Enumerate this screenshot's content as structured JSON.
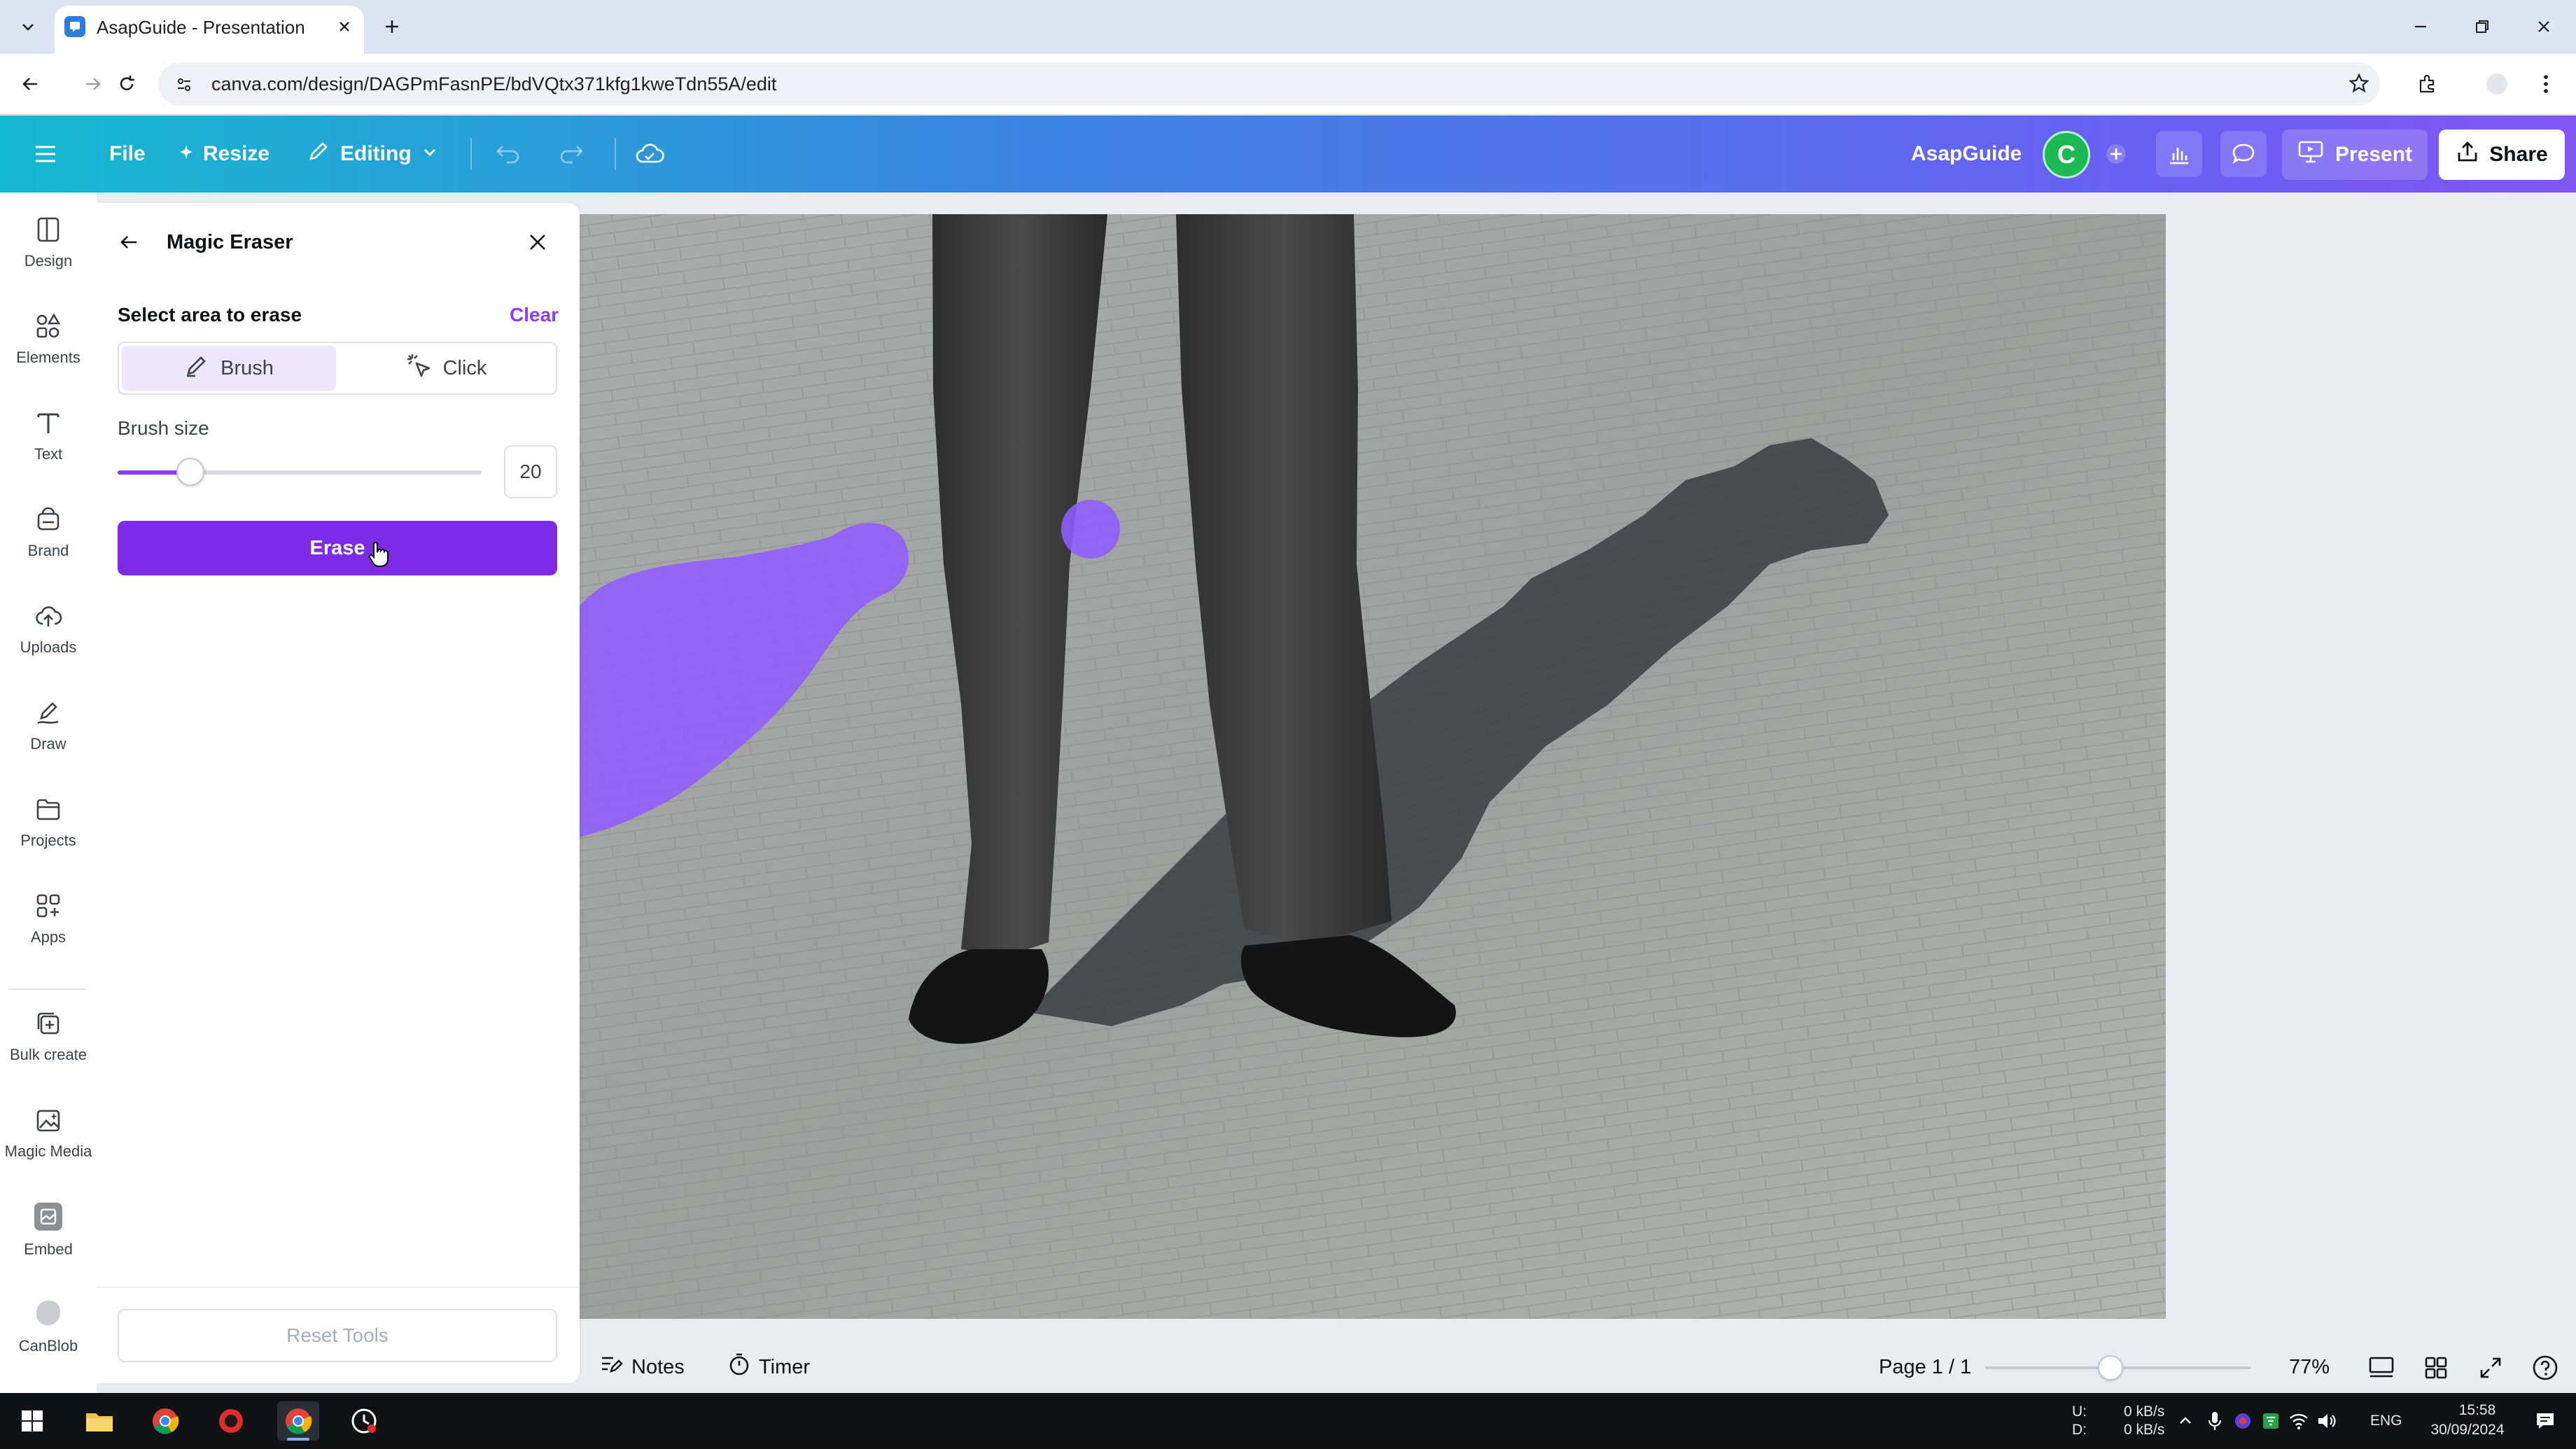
{
  "browser": {
    "tab_title": "AsapGuide - Presentation",
    "url": "canva.com/design/DAGPmFasnPE/bdVQtx371kfg1kweTdn55A/edit"
  },
  "header": {
    "file_label": "File",
    "resize_label": "Resize",
    "editing_label": "Editing",
    "team_name": "AsapGuide",
    "avatar_initial": "C",
    "present_label": "Present",
    "share_label": "Share"
  },
  "sidebar": {
    "items": [
      {
        "label": "Design",
        "icon": "design-icon"
      },
      {
        "label": "Elements",
        "icon": "elements-icon"
      },
      {
        "label": "Text",
        "icon": "text-icon"
      },
      {
        "label": "Brand",
        "icon": "brand-icon"
      },
      {
        "label": "Uploads",
        "icon": "uploads-icon"
      },
      {
        "label": "Draw",
        "icon": "draw-icon"
      },
      {
        "label": "Projects",
        "icon": "projects-icon"
      },
      {
        "label": "Apps",
        "icon": "apps-icon"
      },
      {
        "label": "Bulk create",
        "icon": "bulk-create-icon"
      },
      {
        "label": "Magic Media",
        "icon": "magic-media-icon"
      },
      {
        "label": "Embed",
        "icon": "embed-icon"
      },
      {
        "label": "CanBlob",
        "icon": "canblob-icon"
      }
    ]
  },
  "panel": {
    "title": "Magic Eraser",
    "select_label": "Select area to erase",
    "clear_label": "Clear",
    "modes": [
      "Brush",
      "Click"
    ],
    "active_mode": "Brush",
    "brush_size_label": "Brush size",
    "brush_size_value": "20",
    "brush_size_fraction": 0.2,
    "erase_label": "Erase",
    "reset_label": "Reset Tools"
  },
  "bottom": {
    "notes_label": "Notes",
    "timer_label": "Timer",
    "page_label": "Page 1 / 1",
    "zoom_label": "77%",
    "zoom_fraction": 0.47
  },
  "taskbar": {
    "net_up_label": "U:",
    "net_down_label": "D:",
    "net_up": "0 kB/s",
    "net_down": "0 kB/s",
    "language": "ENG",
    "time": "15:58",
    "date": "30/09/2024"
  },
  "colors": {
    "accent": "#7d2ae8",
    "brush_overlay": "#8f5cff",
    "header_start": "#16b8cf",
    "header_end": "#7f56f2"
  }
}
